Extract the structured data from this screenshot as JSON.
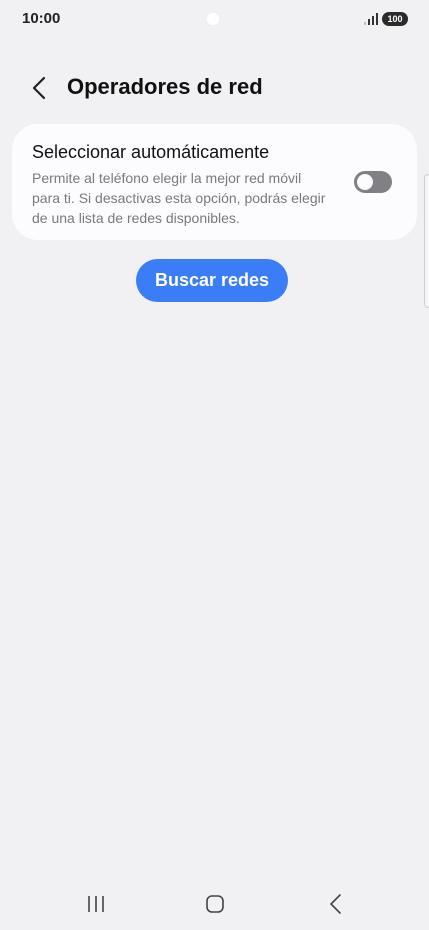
{
  "status_bar": {
    "time": "10:00",
    "battery": "100",
    "icons": [
      "signal-icon",
      "battery-icon"
    ]
  },
  "header": {
    "title": "Operadores de red",
    "back_icon": "chevron-left-icon"
  },
  "auto_select": {
    "title": "Seleccionar automáticamente",
    "description": "Permite al teléfono elegir la mejor red móvil para ti. Si desactivas esta opción, podrás elegir de una lista de redes disponibles.",
    "enabled": false
  },
  "search_button": {
    "label": "Buscar redes"
  },
  "nav_bar": {
    "icons": [
      "recents-icon",
      "home-icon",
      "back-icon"
    ]
  },
  "colors": {
    "background": "#f1f1f3",
    "card": "#fcfcfe",
    "accent": "#3b7cf7",
    "toggle_off": "#808085",
    "secondary_text": "#7a7a7d"
  }
}
